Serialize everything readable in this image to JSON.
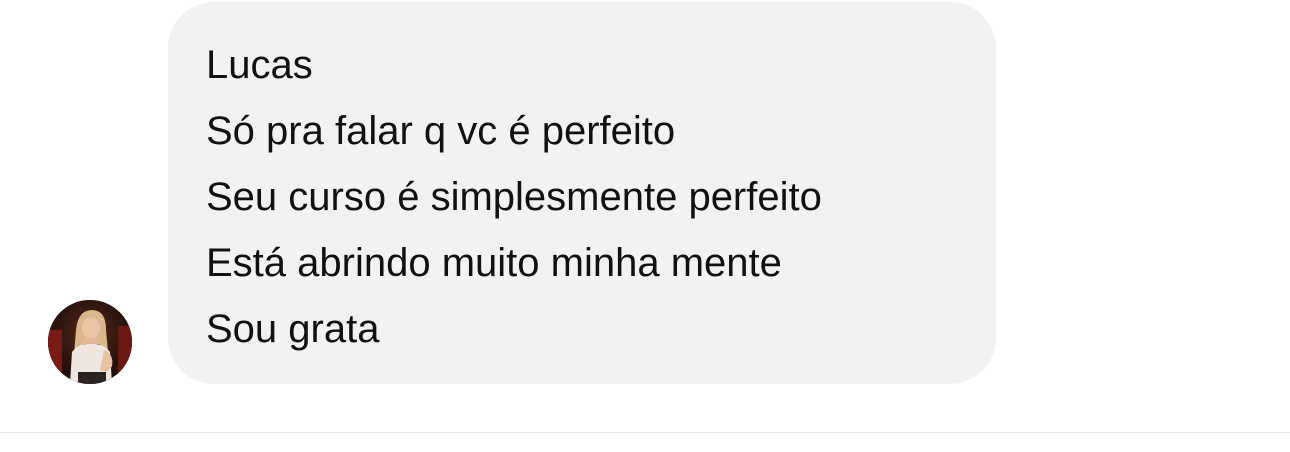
{
  "conversation": {
    "avatar_icon": "profile-photo",
    "message": {
      "lines": [
        "Lucas",
        "Só pra falar q vc é perfeito",
        "Seu curso é simplesmente perfeito",
        "Está abrindo muito minha mente",
        "Sou grata"
      ]
    },
    "colors": {
      "bubble_background": "#f1f2f4",
      "text": "#111111",
      "page_background": "#ffffff",
      "divider": "#e6e6e8"
    }
  }
}
